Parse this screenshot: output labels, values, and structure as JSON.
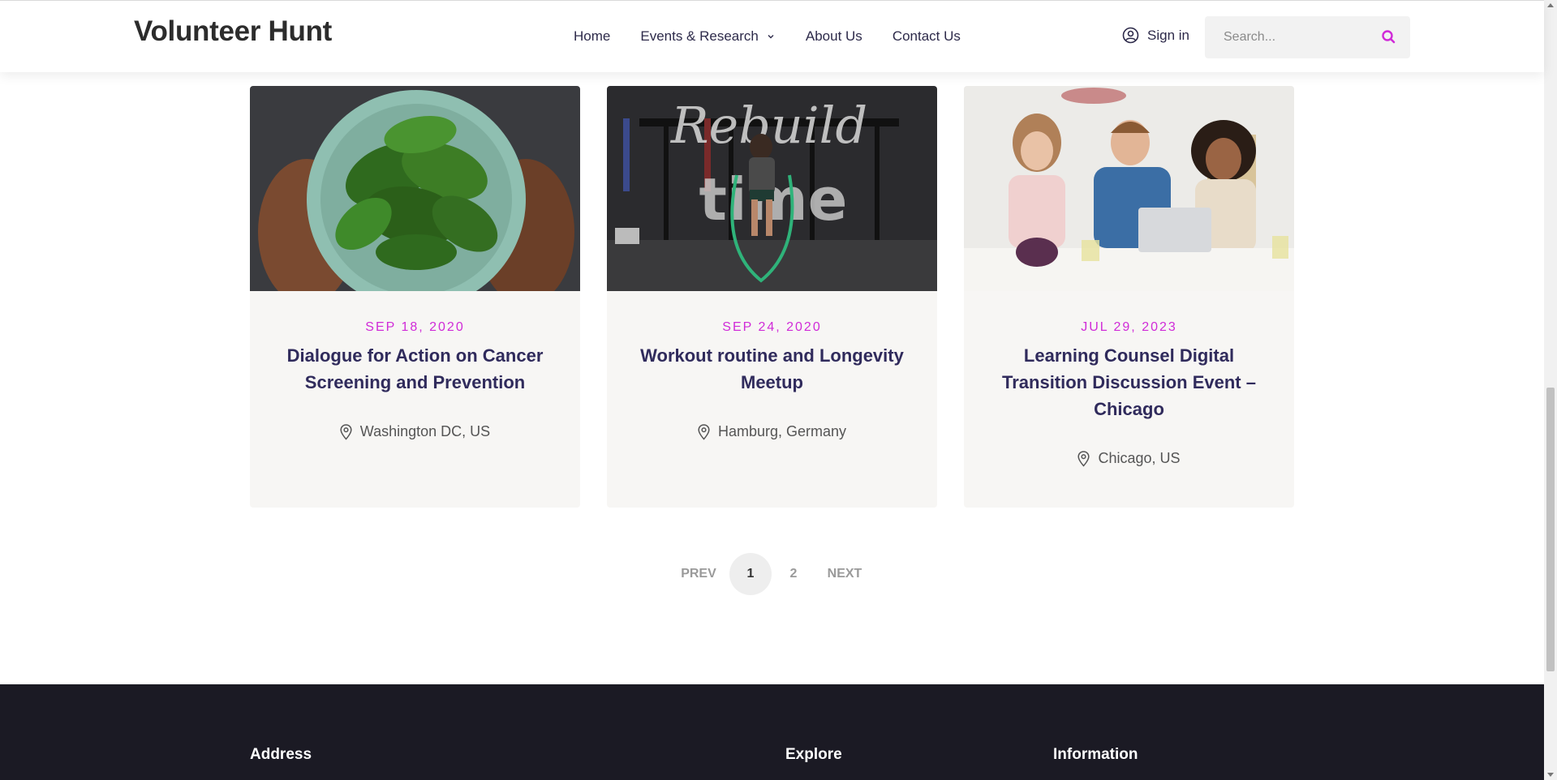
{
  "header": {
    "logo": "Volunteer Hunt",
    "nav": [
      {
        "label": "Home"
      },
      {
        "label": "Events & Research",
        "has_dropdown": true
      },
      {
        "label": "About Us"
      },
      {
        "label": "Contact Us"
      }
    ],
    "signin_label": "Sign in",
    "search_placeholder": "Search..."
  },
  "cards": [
    {
      "date": "SEP 18, 2020",
      "title": "Dialogue for Action on Cancer Screening and Prevention",
      "location": "Washington DC, US",
      "image": "hands holding bowl of spinach"
    },
    {
      "date": "SEP 24, 2020",
      "title": "Workout routine and Longevity Meetup",
      "location": "Hamburg, Germany",
      "image": "person jumping rope in gym"
    },
    {
      "date": "JUL 29, 2023",
      "title": "Learning Counsel Digital Transition Discussion Event – Chicago",
      "location": "Chicago, US",
      "image": "three people at laptop"
    }
  ],
  "pagination": {
    "prev": "PREV",
    "pages": [
      "1",
      "2"
    ],
    "active": "1",
    "next": "NEXT"
  },
  "footer": {
    "columns": [
      "Address",
      "Explore",
      "Information"
    ]
  },
  "colors": {
    "accent": "#d02bd8",
    "title": "#302b5c",
    "footer_bg": "#1b1a24",
    "card_bg": "#f7f6f4"
  }
}
